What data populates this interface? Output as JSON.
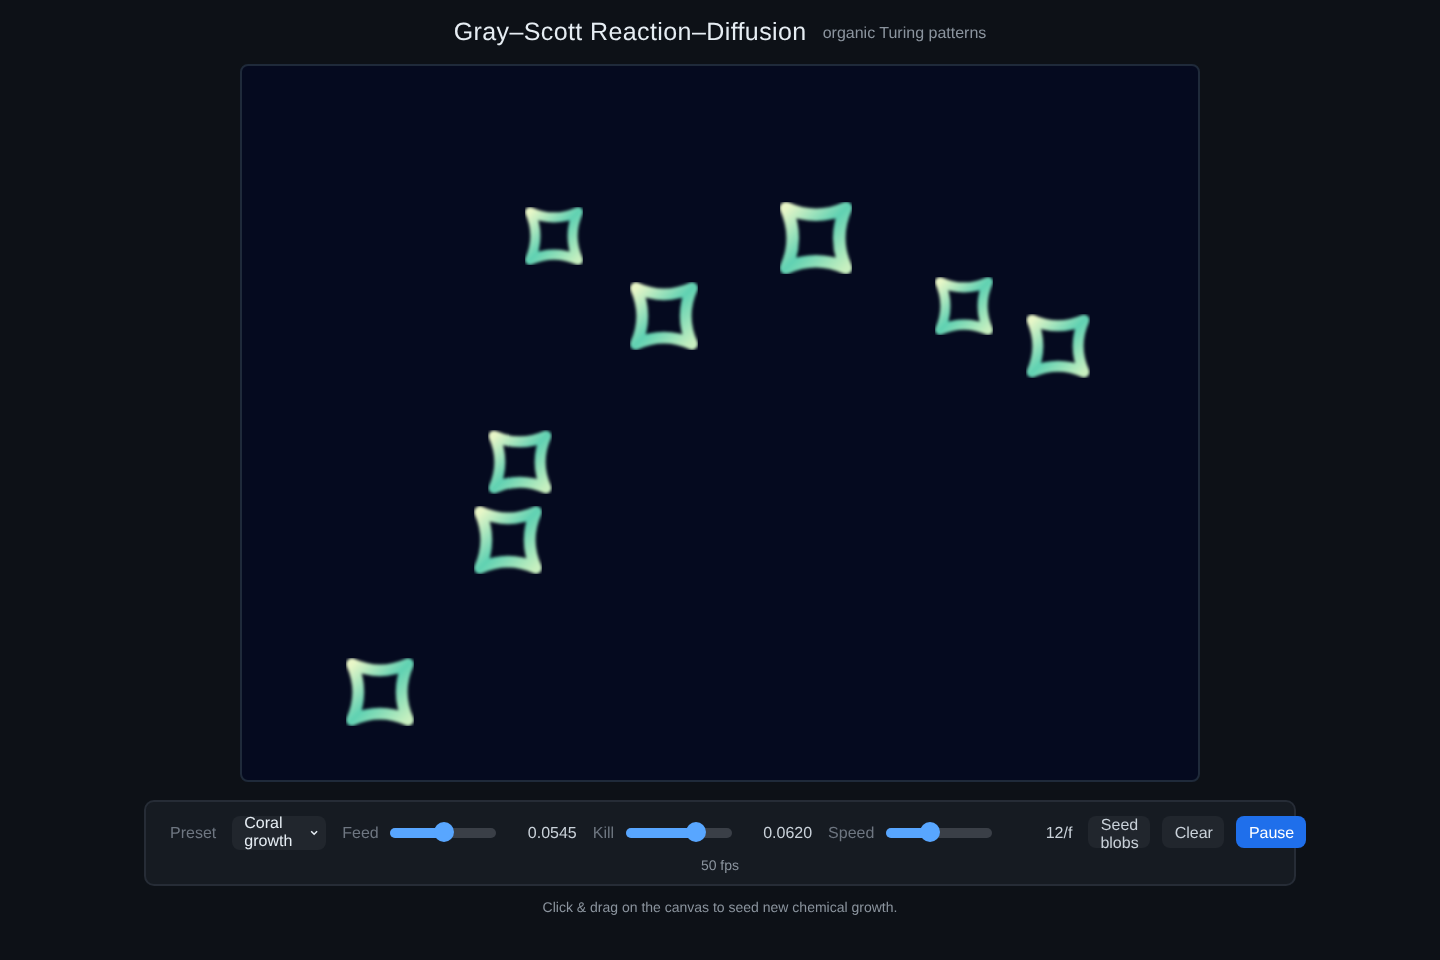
{
  "header": {
    "title": "Gray–Scott Reaction–Diffusion",
    "subtitle": "organic Turing patterns"
  },
  "controls": {
    "preset": {
      "label": "Preset",
      "value": "Coral growth"
    },
    "sliders": [
      {
        "label": "Feed",
        "level": 0.5,
        "reading": "0.0545"
      },
      {
        "label": "Kill",
        "level": 0.66,
        "reading": "0.0620"
      },
      {
        "label": "Speed",
        "level": 0.41,
        "reading": "12/f"
      }
    ],
    "buttons": [
      {
        "label": "Seed blobs",
        "kind": "secondary"
      },
      {
        "label": "Clear",
        "kind": "secondary"
      },
      {
        "label": "Pause",
        "kind": "primary"
      }
    ],
    "status": "50 fps"
  },
  "hint": "Click & drag on the canvas to seed new chemical growth."
}
